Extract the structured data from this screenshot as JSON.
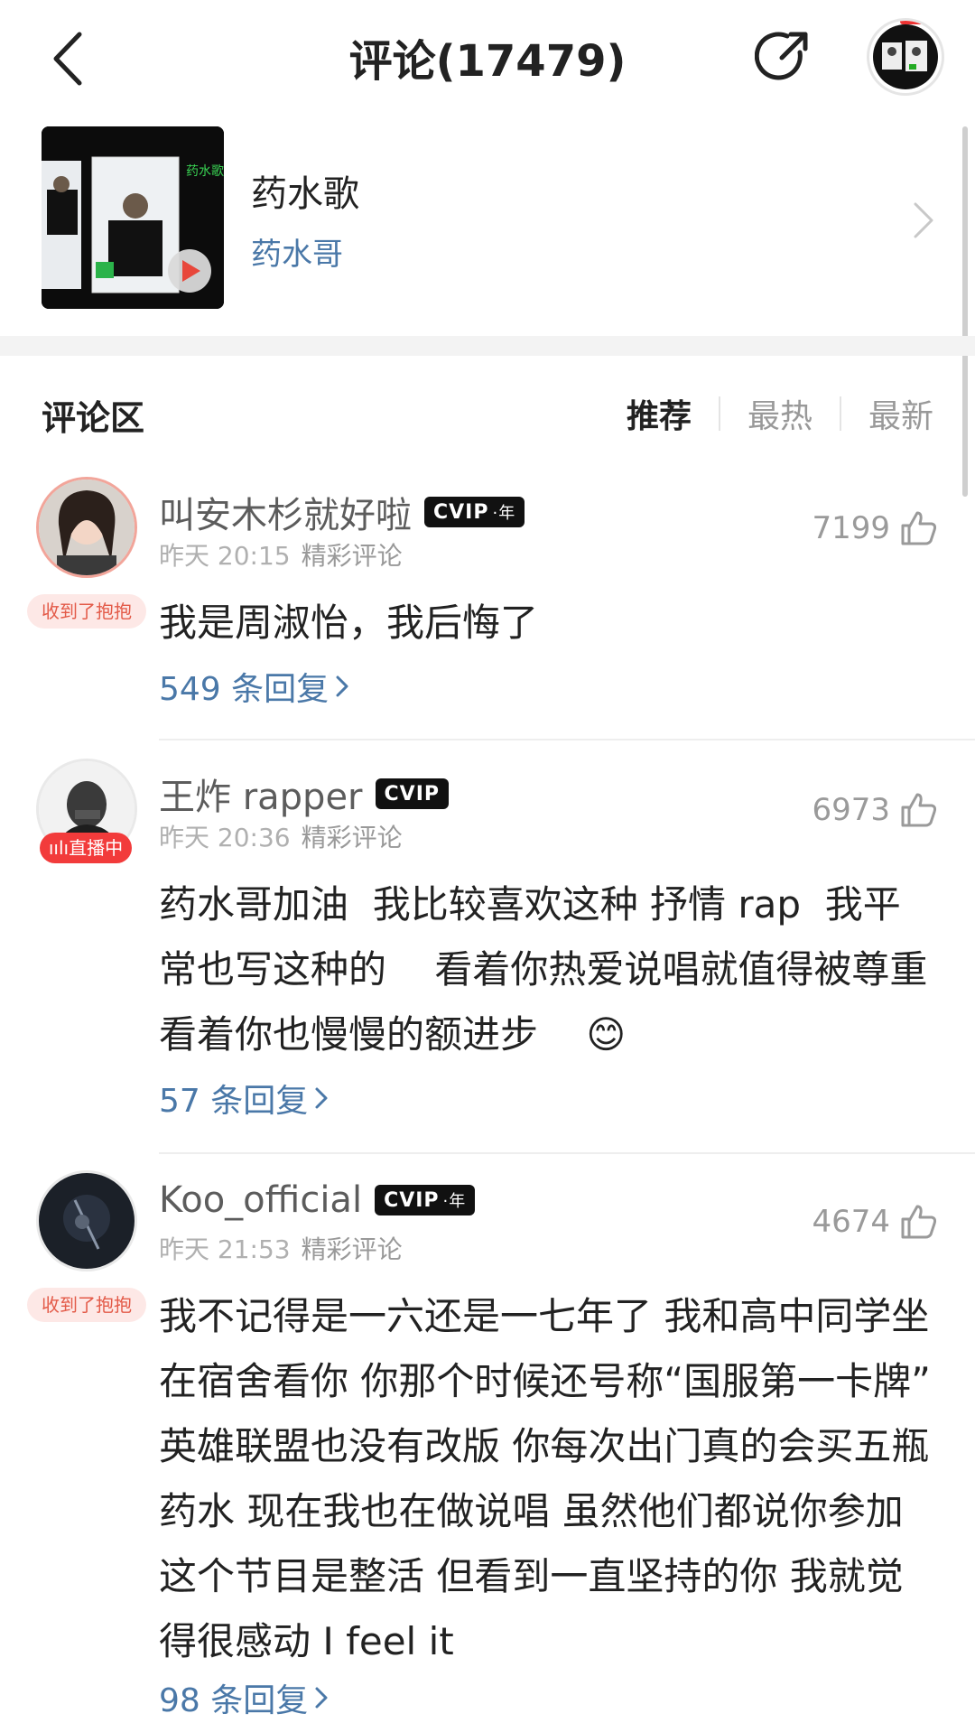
{
  "header": {
    "title": "评论(17479)"
  },
  "song": {
    "title": "药水歌",
    "artist": "药水哥"
  },
  "comments_section": {
    "title": "评论区",
    "sort_tabs": [
      "推荐",
      "最热",
      "最新"
    ],
    "active_tab": "推荐"
  },
  "comments": [
    {
      "username": "叫安木杉就好啦",
      "vip_label": "CVIP",
      "vip_suffix": "年",
      "time": "昨天 20:15",
      "tag": "精彩评论",
      "likes": "7199",
      "badge": "收到了抱抱",
      "text": "我是周淑怡，我后悔了",
      "replies": "549 条回复"
    },
    {
      "username": "王炸 rapper",
      "vip_label": "CVIP",
      "time": "昨天 20:36",
      "tag": "精彩评论",
      "likes": "6973",
      "badge": "直播中",
      "text": "药水哥加油  我比较喜欢这种 抒情 rap  我平常也写这种的    看着你热爱说唱就值得被尊重   看着你也慢慢的额进步    😊",
      "replies": "57 条回复"
    },
    {
      "username": "Koo_official",
      "vip_label": "CVIP",
      "vip_suffix": "年",
      "time": "昨天 21:53",
      "tag": "精彩评论",
      "likes": "4674",
      "badge": "收到了抱抱",
      "text": "我不记得是一六还是一七年了 我和高中同学坐在宿舍看你 你那个时候还号称“国服第一卡牌” 英雄联盟也没有改版 你每次出门真的会买五瓶药水 现在我也在做说唱 虽然他们都说你参加这个节目是整活 但看到一直坚持的你 我就觉得很感动 I feel it",
      "replies": "98 条回复"
    }
  ],
  "colors": {
    "link_blue": "#4a78a8",
    "hug_badge_bg": "#fde8e6",
    "hug_badge_text": "#e35a48",
    "live_badge": "#f23b3b"
  }
}
